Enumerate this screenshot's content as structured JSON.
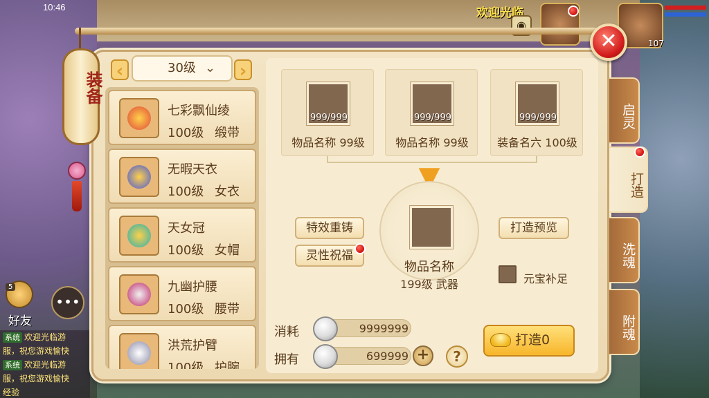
{
  "status": {
    "time": "10:46"
  },
  "hud": {
    "welcome": "欢迎光临",
    "player_level": "107"
  },
  "friends": {
    "label": "好友",
    "count": "5"
  },
  "chat": [
    {
      "tag": "系统",
      "text": "欢迎光临游"
    },
    {
      "tag": "",
      "text": "服，祝您游戏愉快"
    },
    {
      "tag": "系统",
      "text": "欢迎光临游"
    },
    {
      "tag": "",
      "text": "服，祝您游戏愉快"
    },
    {
      "tag": "",
      "text": "经验"
    }
  ],
  "lantern": {
    "title": "装备"
  },
  "level_selector": {
    "value": "30级"
  },
  "items": [
    {
      "name": "七彩飘仙绫",
      "level": "100级",
      "type": "缎带",
      "color": "#e04a3a"
    },
    {
      "name": "无暇天衣",
      "level": "100级",
      "type": "女衣",
      "color": "#4a5ad8"
    },
    {
      "name": "天女冠",
      "level": "100级",
      "type": "女帽",
      "color": "#2ab0b0"
    },
    {
      "name": "九幽护腰",
      "level": "100级",
      "type": "腰带",
      "color": "#c02a6a"
    },
    {
      "name": "洪荒护臂",
      "level": "100级",
      "type": "护腕",
      "color": "#8a8aa8"
    }
  ],
  "materials": [
    {
      "count": "999/999",
      "name": "物品名称 99级"
    },
    {
      "count": "999/999",
      "name": "物品名称 99级"
    },
    {
      "count": "999/999",
      "name": "装备名六 100级"
    }
  ],
  "result": {
    "name": "物品名称",
    "sub": "199级 武器"
  },
  "buttons": {
    "effect_recast": "特效重铸",
    "spirit_bless": "灵性祝福",
    "forge_preview": "打造预览",
    "forge": "打造0"
  },
  "yuanbao": {
    "label": "元宝补足"
  },
  "cost": {
    "consume_label": "消耗",
    "consume_value": "9999999",
    "own_label": "拥有",
    "own_value": "699999"
  },
  "help": "?",
  "plus": "+",
  "close": "✕",
  "tabs": [
    {
      "label": "启灵"
    },
    {
      "label": "打造"
    },
    {
      "label": "洗魂"
    },
    {
      "label": "附魂"
    }
  ]
}
